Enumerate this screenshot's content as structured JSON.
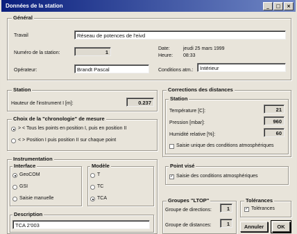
{
  "window": {
    "title": "Données de la station",
    "buttons": [
      "_",
      "□",
      "×"
    ]
  },
  "general": {
    "legend": "Général",
    "travail_label": "Travail",
    "travail_value": "Réseau de potences de l'eivd",
    "station_label": "Numéro de la station:",
    "station_value": "1",
    "date_label": "Date:",
    "date_value": "jeudi 25 mars 1999",
    "heure_label": "Heure:",
    "heure_value": "08:33",
    "operateur_label": "Opérateur:",
    "operateur_value": "Brandt Pascal",
    "conditions_label": "Conditions atm.:",
    "conditions_value": "Intérieur"
  },
  "station": {
    "legend": "Station",
    "hauteur_label": "Hauteur de l'instrument I [m]:",
    "hauteur_value": "0.237"
  },
  "chronologie": {
    "legend": "Choix de la \"chronologie\" de mesure",
    "options": [
      {
        "label": "> < Tous les points en position I, puis en position II",
        "selected": true
      },
      {
        "label": "< > Position I puis position II sur chaque point",
        "selected": false
      }
    ]
  },
  "instrumentation": {
    "legend": "Instrumentation",
    "interface": {
      "legend": "Interface",
      "options": [
        {
          "label": "GeoCOM",
          "selected": true
        },
        {
          "label": "GSI",
          "selected": false
        },
        {
          "label": "Saisie manuelle",
          "selected": false
        }
      ]
    },
    "modele": {
      "legend": "Modèle",
      "options": [
        {
          "label": "T",
          "selected": false
        },
        {
          "label": "TC",
          "selected": false
        },
        {
          "label": "TCA",
          "selected": true
        }
      ]
    },
    "description": {
      "legend": "Description",
      "value": "TCA 2'003"
    }
  },
  "corrections": {
    "legend": "Corrections des distances",
    "station_legend": "Station",
    "temperature_label": "Température [C]:",
    "temperature_value": "21",
    "pression_label": "Pression [mbar]:",
    "pression_value": "960",
    "humidite_label": "Humidité relative [%]:",
    "humidite_value": "60",
    "saisie_unique_label": "Saisie unique des conditions atmosphériques",
    "saisie_unique_checked": false
  },
  "point_vise": {
    "legend": "Point visé",
    "saisie_label": "Saisie des conditions atmosphériques",
    "saisie_checked": true
  },
  "groupes": {
    "legend": "Groupes \"LTOP\"",
    "directions_label": "Groupe de directions:",
    "directions_value": "1",
    "distances_label": "Groupe de distances:",
    "distances_value": "1"
  },
  "tolerances": {
    "legend": "Tolérances",
    "checkbox_label": "Tolérances",
    "checked": true
  },
  "actions": {
    "cancel": "Annuler",
    "ok": "OK"
  }
}
